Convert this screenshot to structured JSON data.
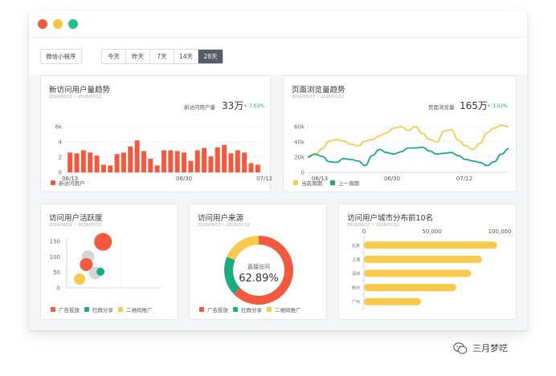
{
  "window": {
    "dots": [
      "#f2593f",
      "#f6c34a",
      "#20c08b"
    ]
  },
  "toolbar": {
    "app_select": "微信小程序",
    "ranges": [
      "今天",
      "昨天",
      "7天",
      "14天",
      "28天"
    ],
    "active_range": "28天"
  },
  "colors": {
    "orange": "#f2593f",
    "green": "#1aab80",
    "yellow": "#f8c94c",
    "gray": "#d5d6d8"
  },
  "new_users": {
    "title": "新访问用户量趋势",
    "date_range": "2016/06/13 ~ 2016/07/12",
    "kpi_label": "新访问用户量",
    "kpi_value": "33万",
    "kpi_delta": "+ 7.03%",
    "legend": "新访问用户",
    "chart_data": {
      "type": "bar",
      "yticks": [
        "0",
        "2",
        "4",
        "6k"
      ],
      "ylim": [
        0,
        6
      ],
      "xticks": [
        "06/13",
        "06/30",
        "07/12"
      ],
      "xtick_index": [
        0,
        17,
        29
      ],
      "values": [
        2.6,
        2.5,
        2.9,
        2.6,
        2.2,
        1.0,
        0.9,
        2.4,
        2.6,
        3.4,
        4.2,
        2.8,
        1.8,
        0.9,
        2.9,
        2.9,
        2.8,
        2.6,
        1.5,
        2.9,
        3.2,
        2.1,
        3.3,
        3.6,
        2.5,
        2.9,
        2.6,
        1.2,
        1.0
      ]
    }
  },
  "page_views": {
    "title": "页面浏览量趋势",
    "date_range": "2016/06/13 ~ 2016/07/12",
    "kpi_label": "页面浏览量",
    "kpi_value": "165万",
    "kpi_delta": "+ 3.03%",
    "legend": [
      "当前周期",
      "上一周期"
    ],
    "chart_data": {
      "type": "line",
      "yticks": [
        "0",
        "20k",
        "40k",
        "60k"
      ],
      "ylim": [
        0,
        60
      ],
      "xticks": [
        "06/13",
        "06/30",
        "07/12"
      ],
      "xtick_pos": [
        0.06,
        0.42,
        0.78
      ],
      "series": [
        {
          "name": "当前周期",
          "color": "#f8c94c",
          "values": [
            22,
            23,
            31,
            41,
            43,
            41,
            37,
            35,
            41,
            43,
            48,
            52,
            58,
            60,
            55,
            60,
            51,
            43,
            40,
            54,
            56,
            42,
            35,
            30,
            38,
            52,
            58,
            62,
            60
          ]
        },
        {
          "name": "上一周期",
          "color": "#1aab80",
          "values": [
            20,
            24,
            21,
            14,
            13,
            18,
            17,
            15,
            9,
            22,
            30,
            26,
            24,
            27,
            32,
            32,
            33,
            28,
            24,
            25,
            26,
            22,
            17,
            15,
            13,
            9,
            14,
            24,
            31
          ]
        }
      ]
    }
  },
  "activity": {
    "title": "访问用户活跃度",
    "date_range": "2016/06/13 ~ 2016/07/12",
    "legend": [
      "广告投放",
      "社群分享",
      "二维码推广"
    ],
    "chart_data": {
      "type": "scatter",
      "yticks": [
        "0",
        "50",
        "100",
        "150"
      ],
      "ylim": [
        0,
        160
      ],
      "xlim": [
        0,
        100
      ],
      "points": [
        {
          "x": 12,
          "y": 100,
          "r": 8,
          "series": "gray"
        },
        {
          "x": 10,
          "y": 75,
          "r": 8,
          "series": "orange"
        },
        {
          "x": 30,
          "y": 148,
          "r": 11,
          "series": "orange"
        },
        {
          "x": 21,
          "y": 48,
          "r": 8,
          "series": "gray"
        },
        {
          "x": 27,
          "y": 52,
          "r": 5,
          "series": "green"
        },
        {
          "x": 2,
          "y": 28,
          "r": 7,
          "series": "yellow"
        }
      ]
    }
  },
  "sources": {
    "title": "访问用户来源",
    "date_range": "2016/06/13 ~ 2016/07/12",
    "center_label": "直接访问",
    "center_value": "62.89%",
    "legend": [
      "广告投放",
      "社群分享",
      "二维码推广"
    ],
    "chart_data": {
      "type": "pie",
      "slices": [
        {
          "name": "直接访问",
          "value": 62.89,
          "color": "#f2593f"
        },
        {
          "name": "社群分享",
          "value": 18.5,
          "color": "#1aab80"
        },
        {
          "name": "二维码推广",
          "value": 18.61,
          "color": "#f8c94c"
        }
      ]
    }
  },
  "cities": {
    "title": "访问用户城市分布前10名",
    "date_range": "2016/06/13 ~ 2016/07/12",
    "chart_data": {
      "type": "bar",
      "orientation": "horizontal",
      "xticks": [
        "0",
        "50,000",
        "100,000"
      ],
      "xlim": [
        0,
        100000
      ],
      "categories": [
        "北京",
        "上海",
        "深圳",
        "杭州",
        "广州"
      ],
      "values": [
        98000,
        87000,
        79000,
        68000,
        42000
      ],
      "color": "#f8c94c"
    }
  },
  "watermark": {
    "text": "三月梦呓"
  }
}
